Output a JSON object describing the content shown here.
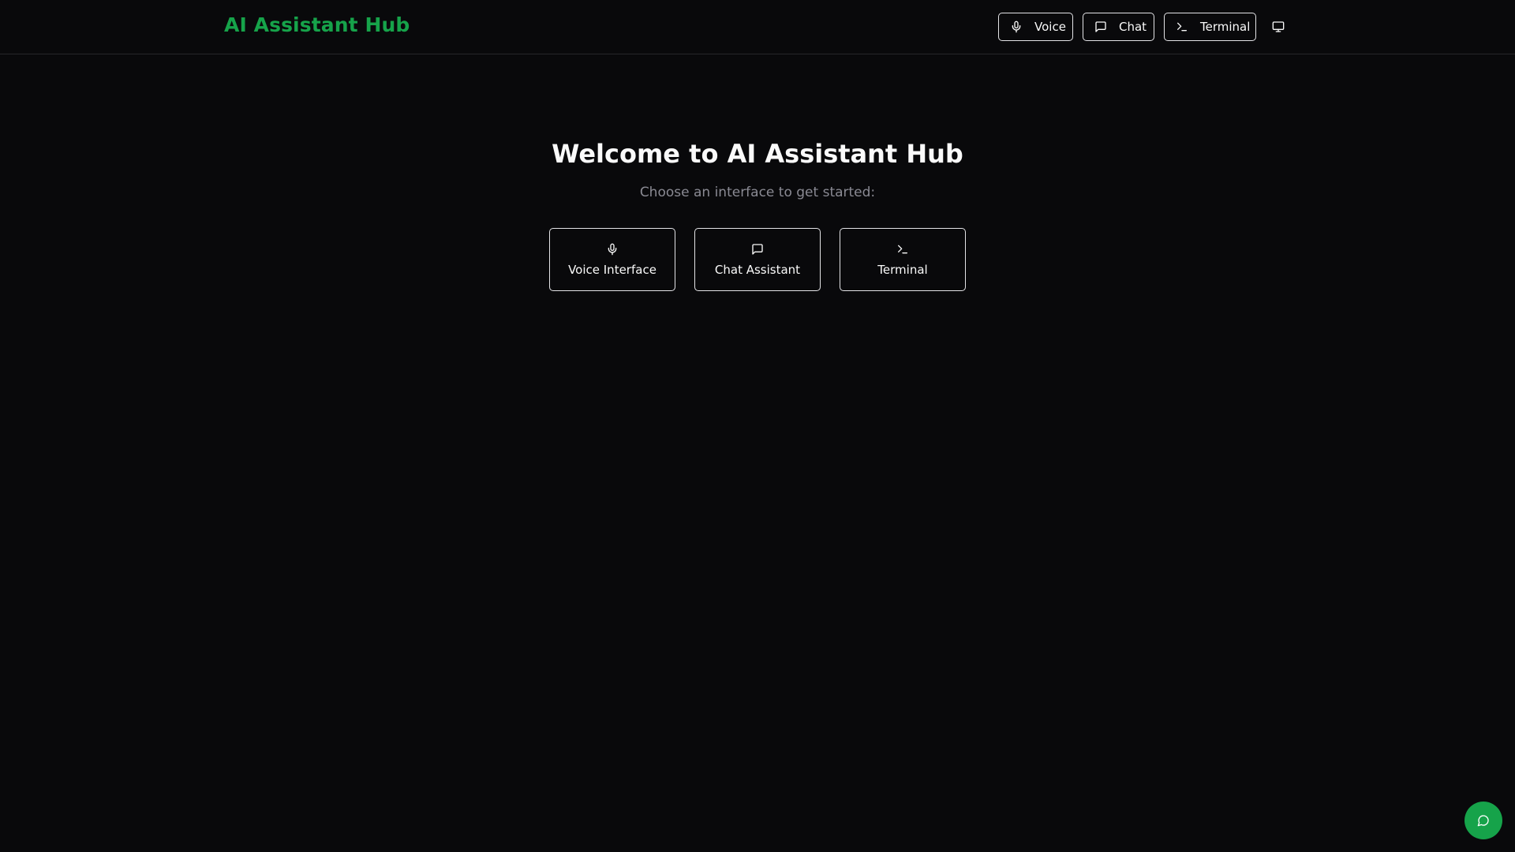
{
  "app": {
    "brand": "AI Assistant Hub",
    "brand_color": "#16a34a"
  },
  "nav": {
    "items": [
      {
        "label": "Voice",
        "icon": "mic-icon"
      },
      {
        "label": "Chat",
        "icon": "message-square-icon"
      },
      {
        "label": "Terminal",
        "icon": "terminal-icon"
      }
    ],
    "monitor_icon": "monitor-icon"
  },
  "hero": {
    "title": "Welcome to AI Assistant Hub",
    "subtitle": "Choose an interface to get started:"
  },
  "cards": [
    {
      "label": "Voice Interface",
      "icon": "mic-icon"
    },
    {
      "label": "Chat Assistant",
      "icon": "message-square-icon"
    },
    {
      "label": "Terminal",
      "icon": "terminal-icon"
    }
  ],
  "fab": {
    "icon": "message-circle-icon",
    "color": "#16a34a"
  }
}
